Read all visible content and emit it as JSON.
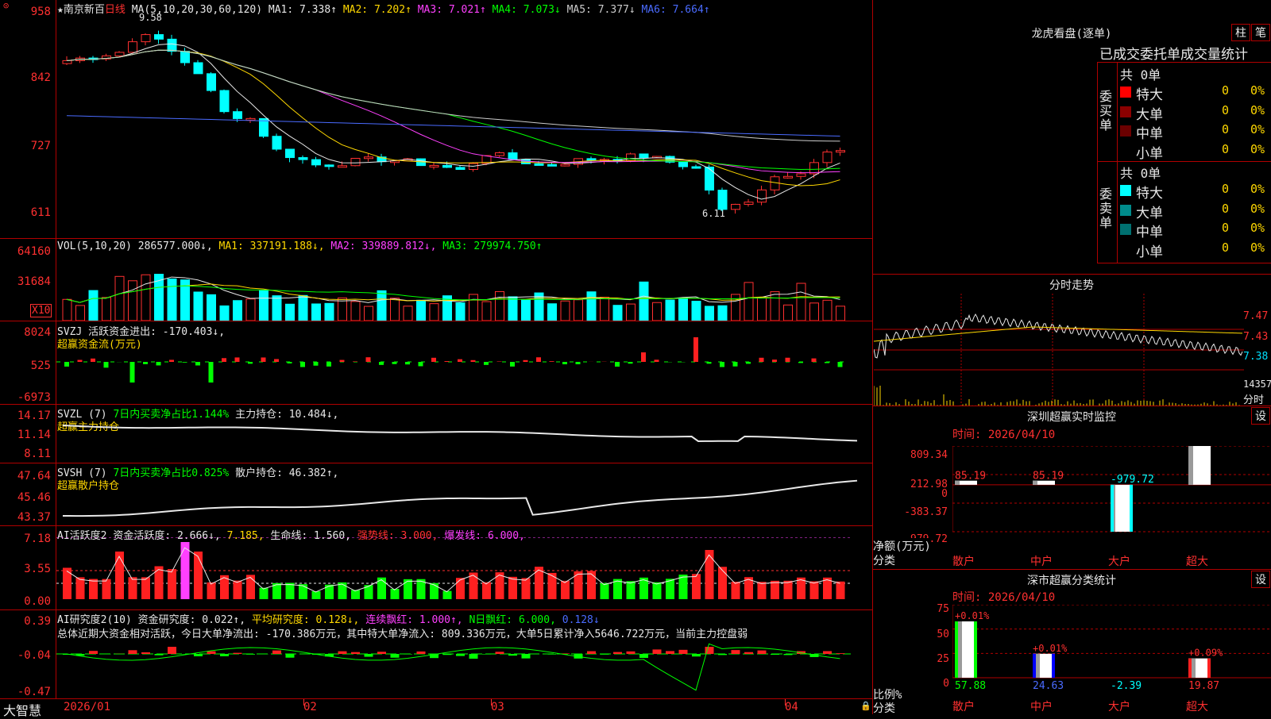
{
  "stock": {
    "star": "★",
    "name": "南京新百",
    "period": "日线"
  },
  "ma_line": {
    "label": "MA(5,10,20,30,60,120)",
    "items": [
      {
        "t": "MA1: 7.338↑",
        "c": "#e8e8e8"
      },
      {
        "t": "MA2: 7.202↑",
        "c": "#ffd800"
      },
      {
        "t": "MA3: 7.021↑",
        "c": "#ff40ff"
      },
      {
        "t": "MA4: 7.073↓",
        "c": "#00ff00"
      },
      {
        "t": "MA5: 7.377↓",
        "c": "#cccccc"
      },
      {
        "t": "MA6: 7.664↑",
        "c": "#4a6bff"
      }
    ]
  },
  "price_axis": [
    "958",
    "842",
    "727",
    "611"
  ],
  "high_label": "9.58",
  "low_label": "6.11",
  "vol": {
    "label": "VOL(5,10,20)",
    "val": "286577.000↓,",
    "ma1": "MA1: 337191.188↓,",
    "ma2": "MA2: 339889.812↓,",
    "ma3": "MA3: 279974.750↑",
    "axis": [
      "64160",
      "31684"
    ],
    "unit": "X10"
  },
  "svzj": {
    "label": "SVZJ",
    "desc": "活跃资金进出: -170.403↓,",
    "sub": "超赢资金流(万元)",
    "axis": [
      "8024",
      "525",
      "-6973"
    ]
  },
  "svzl": {
    "label": "SVZL (7)",
    "desc": "7日内买卖净占比1.144%",
    "pos": "主力持仓: 10.484↓,",
    "sub": "超赢主力持仓",
    "axis": [
      "14.17",
      "11.14",
      "8.11"
    ]
  },
  "svsh": {
    "label": "SVSH (7)",
    "desc": "7日内买卖净占比0.825%",
    "pos": "散户持仓: 46.382↑,",
    "sub": "超赢散户持仓",
    "axis": [
      "47.64",
      "45.46",
      "43.37"
    ]
  },
  "ai_active": {
    "label": "AI活跃度2",
    "a": "资金活跃度: 2.666↓,",
    "b": "7.185,",
    "c": "生命线: 1.560,",
    "d": "强势线: 3.000,",
    "e": "爆发线: 6.000,",
    "axis": [
      "7.18",
      "3.55",
      "0.00"
    ]
  },
  "ai_research": {
    "label": "AI研究度2(10)",
    "a": "资金研究度: 0.022↑,",
    "b": "平均研究度: 0.128↓,",
    "c": "连续飘红: 1.000↑,",
    "d": "N日飘红: 6.000,",
    "e": "0.128↓",
    "summary": "总体近期大资金相对活跃，今日大单净流出: -170.386万元，其中特大单净流入: 809.336万元，大单5日累计净入5646.722万元，当前主力控盘弱",
    "axis": [
      "0.39",
      "-0.04",
      "-0.47"
    ]
  },
  "x_axis": [
    "2026/01",
    "02",
    "03",
    "04"
  ],
  "brand": "大智慧",
  "right": {
    "title": "龙虎看盘(逐单)",
    "btn_zhu": "柱",
    "btn_bi": "笔",
    "header": "已成交委托单成交量统计",
    "buy_side": "委买单",
    "sell_side": "委卖单",
    "buy_total": "共 0单",
    "sell_total": "共 0单",
    "buy_rows": [
      {
        "label": "特大",
        "val": "0",
        "pct": "0%",
        "color": "#ff0000"
      },
      {
        "label": "大单",
        "val": "0",
        "pct": "0%",
        "color": "#8b0000"
      },
      {
        "label": "中单",
        "val": "0",
        "pct": "0%",
        "color": "#6b0000"
      },
      {
        "label": "小单",
        "val": "0",
        "pct": "0%",
        "color": ""
      }
    ],
    "sell_rows": [
      {
        "label": "特大",
        "val": "0",
        "pct": "0%",
        "color": "#00ffff"
      },
      {
        "label": "大单",
        "val": "0",
        "pct": "0%",
        "color": "#008b8b"
      },
      {
        "label": "中单",
        "val": "0",
        "pct": "0%",
        "color": "#007070"
      },
      {
        "label": "小单",
        "val": "0",
        "pct": "0%",
        "color": ""
      }
    ],
    "intraday_title": "分时走势",
    "intraday_axis": [
      "7.47",
      "7.43",
      "7.38"
    ],
    "intraday_vol": "14357",
    "intraday_unit": "分时",
    "sz_title": "深圳超赢实时监控",
    "sz_btn": "设",
    "sz_time": "时间: 2026/04/10",
    "sz_axis": [
      "809.34",
      "212.98",
      "0",
      "-383.37",
      "-979.72"
    ],
    "sz_ylabel": "净额(万元)",
    "sz_xlabel": "分类",
    "sz_bars": [
      {
        "cat": "散户",
        "val": 85.19,
        "label": "85.19"
      },
      {
        "cat": "中户",
        "val": 85.19,
        "label": "85.19"
      },
      {
        "cat": "大户",
        "val": -979.72,
        "label": "-979.72"
      },
      {
        "cat": "超大",
        "val": 809.34,
        "label": "809.34"
      }
    ],
    "cls_title": "深市超赢分类统计",
    "cls_btn": "设",
    "cls_time": "时间: 2026/04/10",
    "cls_axis": [
      "75",
      "50",
      "25",
      "0"
    ],
    "cls_ylabel": "比例%",
    "cls_xlabel": "分类",
    "cls_bars": [
      {
        "cat": "散户",
        "val": 57.88,
        "label": "57.88",
        "chg": "+0.01%"
      },
      {
        "cat": "中户",
        "val": 24.63,
        "label": "24.63",
        "chg": "+0.01%"
      },
      {
        "cat": "大户",
        "val": -2.39,
        "label": "-2.39",
        "chg": ""
      },
      {
        "cat": "超大",
        "val": 19.87,
        "label": "19.87",
        "chg": "+0.09%"
      }
    ]
  },
  "chart_data": {
    "type": "bar",
    "title": "深圳超赢实时监控",
    "categories": [
      "散户",
      "中户",
      "大户",
      "超大"
    ],
    "values": [
      85.19,
      85.19,
      -979.72,
      809.34
    ],
    "ylabel": "净额(万元)",
    "ylim": [
      -979.72,
      809.34
    ]
  }
}
